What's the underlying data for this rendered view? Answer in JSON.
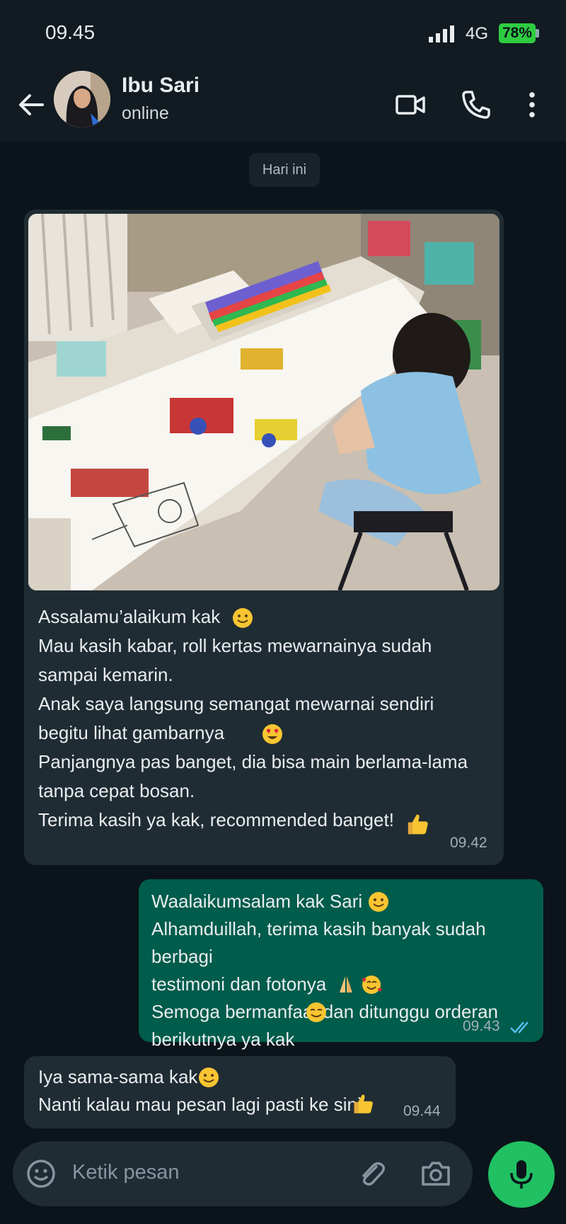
{
  "status_bar": {
    "time": "09.45",
    "network": "4G",
    "battery": "78%"
  },
  "header": {
    "contact_name": "Ibu Sari",
    "contact_status": "online"
  },
  "chat": {
    "date_chip": "Hari ini",
    "messages": [
      {
        "direction": "incoming",
        "has_image": true,
        "text": "Assalamu’alaikum kak\nMau kasih kabar, roll kertas mewarnainya sudah\nsampai kemarin.\nAnak saya langsung semangat mewarnai sendiri\nbegitu lihat gambarnya\nPanjangnya pas banget, dia bisa main berlama-lama\ntanpa cepat bosan.\nTerima kasih ya kak, recommended banget!",
        "time": "09.42"
      },
      {
        "direction": "outgoing",
        "text": "Waalaikumsalam kak Sari\nAlhamduillah, terima kasih banyak sudah berbagi\ntestimoni dan fotonya\nSemoga bermanfaat dan ditunggu orderan\nberikutnya ya kak",
        "time": "09.43",
        "status": "read"
      },
      {
        "direction": "incoming",
        "text": "Iya sama-sama kak\nNanti kalau mau pesan lagi pasti ke sini",
        "time": "09.44"
      }
    ]
  },
  "input": {
    "placeholder": "Ketik pesan"
  },
  "colors": {
    "background": "#0b141a",
    "incoming_bubble": "#202c33",
    "outgoing_bubble": "#005c4b",
    "accent": "#21c063",
    "read_ticks": "#53bdeb"
  }
}
